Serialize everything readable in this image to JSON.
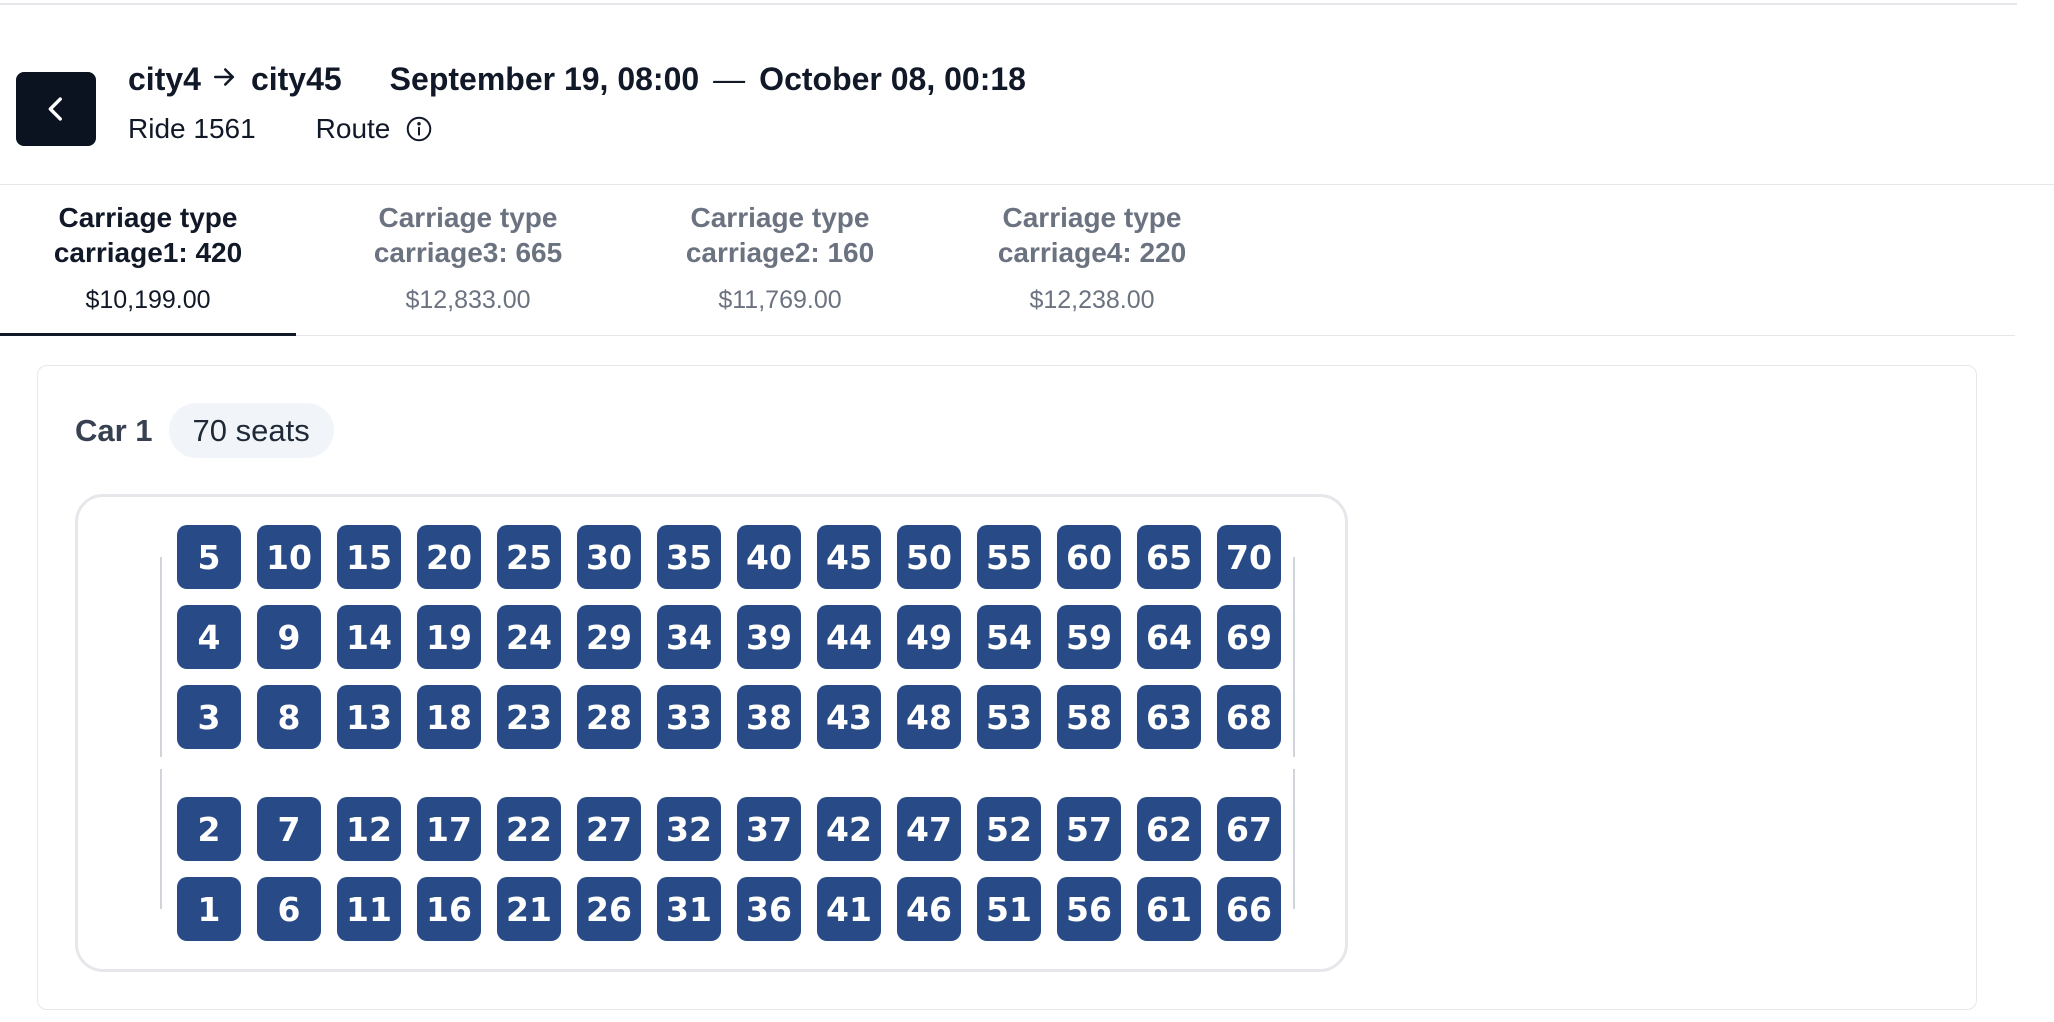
{
  "header": {
    "from_city": "city4",
    "to_city": "city45",
    "departure": "September 19, 08:00",
    "dash": "—",
    "arrival": "October 08, 00:18",
    "ride_label": "Ride 1561",
    "route_label": "Route",
    "back_icon": "chevron-left-icon",
    "arrow_icon": "arrow-right-icon",
    "info_icon": "info-circle-icon"
  },
  "tabs": [
    {
      "name": "Carriage type\ncarriage1: 420",
      "price": "$10,199.00",
      "active": true
    },
    {
      "name": "Carriage type\ncarriage3: 665",
      "price": "$12,833.00",
      "active": false
    },
    {
      "name": "Carriage type\ncarriage2: 160",
      "price": "$11,769.00",
      "active": false
    },
    {
      "name": "Carriage type\ncarriage4: 220",
      "price": "$12,238.00",
      "active": false
    }
  ],
  "car": {
    "label": "Car 1",
    "seats_badge": "70 seats",
    "seat_color": "#284a87",
    "rows": [
      [
        "5",
        "10",
        "15",
        "20",
        "25",
        "30",
        "35",
        "40",
        "45",
        "50",
        "55",
        "60",
        "65",
        "70"
      ],
      [
        "4",
        "9",
        "14",
        "19",
        "24",
        "29",
        "34",
        "39",
        "44",
        "49",
        "54",
        "59",
        "64",
        "69"
      ],
      [
        "3",
        "8",
        "13",
        "18",
        "23",
        "28",
        "33",
        "38",
        "43",
        "48",
        "53",
        "58",
        "63",
        "68"
      ],
      [
        "2",
        "7",
        "12",
        "17",
        "22",
        "27",
        "32",
        "37",
        "42",
        "47",
        "52",
        "57",
        "62",
        "67"
      ],
      [
        "1",
        "6",
        "11",
        "16",
        "21",
        "26",
        "31",
        "36",
        "41",
        "46",
        "51",
        "56",
        "61",
        "66"
      ]
    ]
  }
}
